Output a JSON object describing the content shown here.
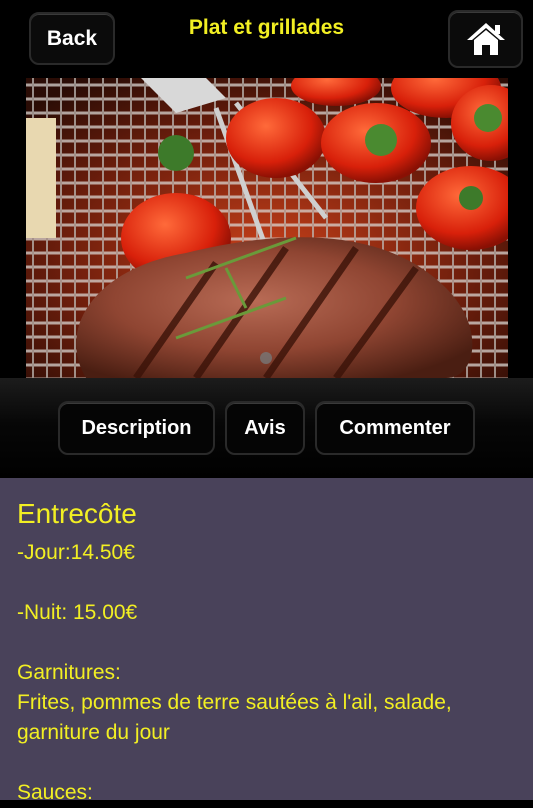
{
  "header": {
    "back_label": "Back",
    "title": "Plat et grillades",
    "home_icon": "home-icon"
  },
  "photo": {
    "description": "grilled-steak-with-tomatoes"
  },
  "tabs": [
    {
      "label": "Description"
    },
    {
      "label": "Avis"
    },
    {
      "label": "Commenter"
    }
  ],
  "content": {
    "dish_name": "Entrecôte",
    "price_day": "-Jour:14.50€",
    "price_night": "-Nuit: 15.00€",
    "garnish_heading": "Garnitures:",
    "garnish_line1": "Frites, pommes de terre sautées à l'ail, salade,",
    "garnish_line2": "garniture du jour",
    "sauces_heading": "Sauces:"
  },
  "colors": {
    "accent_yellow": "#f2ef23",
    "content_bg": "#49425a",
    "bar_bg": "#000000"
  }
}
